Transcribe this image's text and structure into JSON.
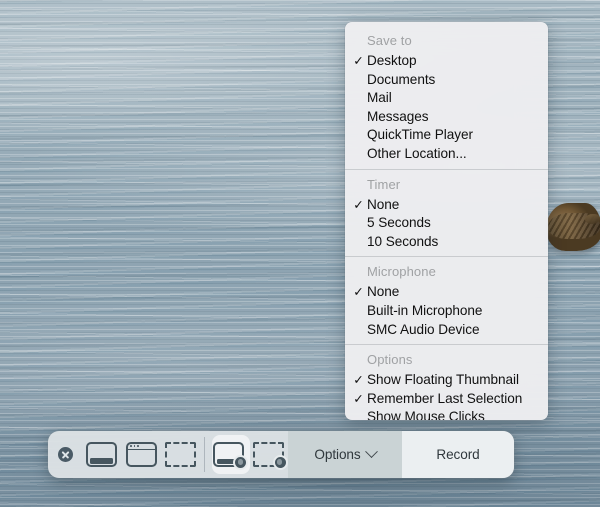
{
  "scene": {
    "description": "macOS Screenshot toolbar over a sea background with a rock",
    "background_color": "#93a8b5",
    "rock_color": "#6f5737"
  },
  "options_menu": {
    "sections": [
      {
        "header": "Save to",
        "items": [
          {
            "label": "Desktop",
            "checked": true
          },
          {
            "label": "Documents",
            "checked": false
          },
          {
            "label": "Mail",
            "checked": false
          },
          {
            "label": "Messages",
            "checked": false
          },
          {
            "label": "QuickTime Player",
            "checked": false
          },
          {
            "label": "Other Location...",
            "checked": false
          }
        ]
      },
      {
        "header": "Timer",
        "items": [
          {
            "label": "None",
            "checked": true
          },
          {
            "label": "5 Seconds",
            "checked": false
          },
          {
            "label": "10 Seconds",
            "checked": false
          }
        ]
      },
      {
        "header": "Microphone",
        "items": [
          {
            "label": "None",
            "checked": true
          },
          {
            "label": "Built-in Microphone",
            "checked": false
          },
          {
            "label": "SMC Audio Device",
            "checked": false
          }
        ]
      },
      {
        "header": "Options",
        "items": [
          {
            "label": "Show Floating Thumbnail",
            "checked": true
          },
          {
            "label": "Remember Last Selection",
            "checked": true
          },
          {
            "label": "Show Mouse Clicks",
            "checked": false
          }
        ]
      }
    ],
    "checkmark_glyph": "✓"
  },
  "toolbar": {
    "close_icon": "close-x-icon",
    "tools": [
      {
        "name": "capture-entire-screen",
        "icon": "screen-icon",
        "selected": false
      },
      {
        "name": "capture-selected-window",
        "icon": "window-icon",
        "selected": false
      },
      {
        "name": "capture-selected-portion",
        "icon": "dashed-selection-icon",
        "selected": false
      },
      {
        "name": "record-entire-screen",
        "icon": "screen-record-icon",
        "selected": true
      },
      {
        "name": "record-selected-portion",
        "icon": "dashed-record-icon",
        "selected": false
      }
    ],
    "options_label": "Options",
    "options_chevron": "chevron-down-icon",
    "record_label": "Record"
  }
}
